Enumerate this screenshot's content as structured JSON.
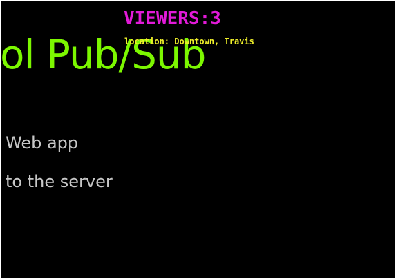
{
  "slide": {
    "title": "ol Pub/Sub",
    "bullets": [
      "Web app",
      "to the server"
    ]
  },
  "overlay": {
    "viewers": "VIEWERS:3",
    "location": "location: Downtown, Travis"
  },
  "colors": {
    "background": "#000000",
    "title": "#7cf700",
    "bullet_text": "#c8c8c8",
    "viewers": "#e21ad8",
    "location": "#f0f02a"
  }
}
